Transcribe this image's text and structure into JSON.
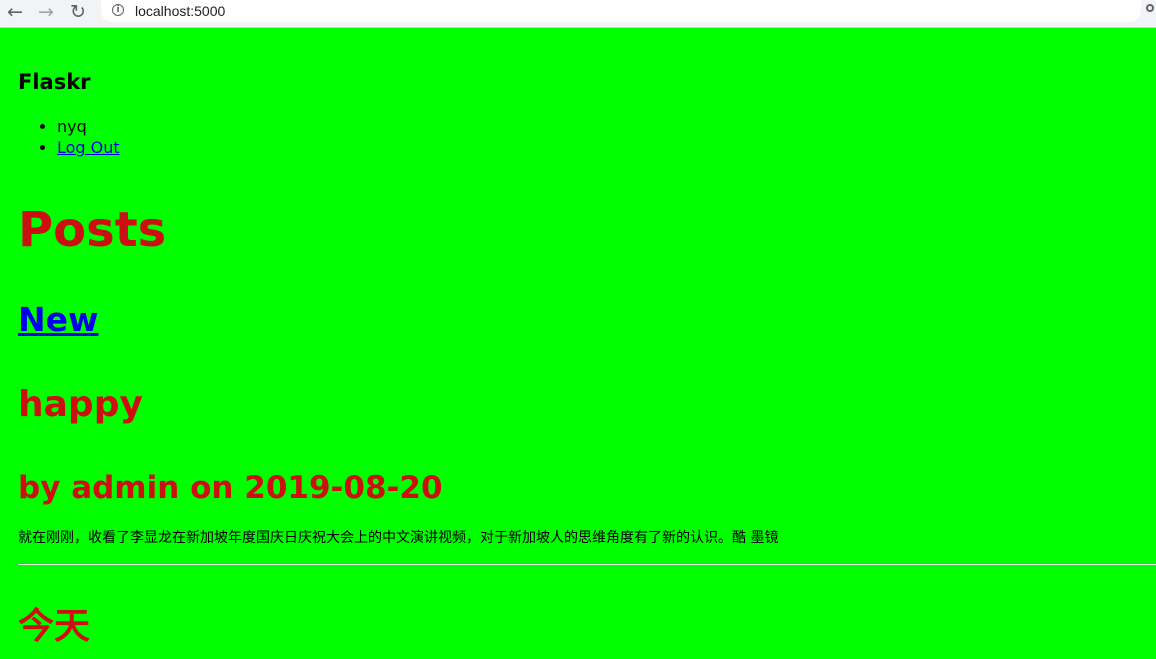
{
  "browser": {
    "url": "localhost:5000",
    "back_icon": "←",
    "forward_icon": "→",
    "reload_icon": "↻",
    "info_icon": "i"
  },
  "header": {
    "brand": "Flaskr",
    "nav": {
      "username": "nyq",
      "logout_label": "Log Out"
    }
  },
  "main": {
    "title": "Posts",
    "new_label": "New",
    "posts": [
      {
        "title": "happy",
        "about": "by admin on 2019-08-20",
        "body": "就在刚刚，收看了李显龙在新加坡年度国庆日庆祝大会上的中文演讲视频，对于新加坡人的思维角度有了新的认识。酷 墨镜"
      },
      {
        "title": "今天"
      }
    ]
  },
  "colors": {
    "background": "#00ff00",
    "heading": "#cc1010",
    "link": "#0000ee"
  }
}
